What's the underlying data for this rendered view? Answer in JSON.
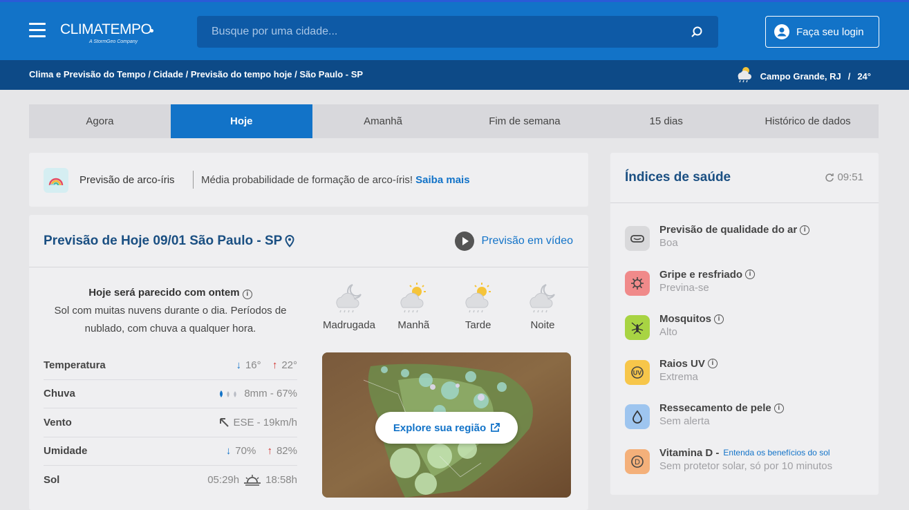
{
  "header": {
    "logo_text": "CLIMATEMPO",
    "logo_subtitle": "A StormGeo Company",
    "search_placeholder": "Busque por uma cidade...",
    "login_label": "Faça seu login"
  },
  "breadcrumb": {
    "items": [
      "Clima e Previsão do Tempo",
      "Cidade",
      "Previsão do tempo hoje",
      "São Paulo - SP"
    ],
    "separator": " / "
  },
  "current_location": {
    "city": "Campo Grande, RJ",
    "temp": "24°",
    "icon": "sun-cloud-rain-icon"
  },
  "tabs": [
    {
      "label": "Agora",
      "active": false
    },
    {
      "label": "Hoje",
      "active": true
    },
    {
      "label": "Amanhã",
      "active": false
    },
    {
      "label": "Fim de semana",
      "active": false
    },
    {
      "label": "15 dias",
      "active": false
    },
    {
      "label": "Histórico de dados",
      "active": false
    }
  ],
  "rainbow": {
    "title": "Previsão de arco-íris",
    "text": "Média probabilidade de formação de arco-íris!",
    "link": "Saiba mais"
  },
  "forecast": {
    "title": "Previsão de Hoje 09/01 São Paulo - SP",
    "video_label": "Previsão em vídeo",
    "summary_heading": "Hoje será parecido com ontem",
    "summary_text": "Sol com muitas nuvens durante o dia. Períodos de nublado, com chuva a qualquer hora.",
    "periods": [
      {
        "label": "Madrugada",
        "icon": "moon-cloud-rain-icon"
      },
      {
        "label": "Manhã",
        "icon": "sun-cloud-rain-icon"
      },
      {
        "label": "Tarde",
        "icon": "sun-cloud-rain-icon"
      },
      {
        "label": "Noite",
        "icon": "moon-cloud-rain-icon"
      }
    ],
    "stats": {
      "temperatura": {
        "label": "Temperatura",
        "min": "16°",
        "max": "22°"
      },
      "chuva": {
        "label": "Chuva",
        "value": "8mm - 67%"
      },
      "vento": {
        "label": "Vento",
        "value": "ESE - 19km/h"
      },
      "umidade": {
        "label": "Umidade",
        "min": "70%",
        "max": "82%"
      },
      "sol": {
        "label": "Sol",
        "sunrise": "05:29h",
        "sunset": "18:58h"
      }
    },
    "map_button": "Explore sua região"
  },
  "health": {
    "title": "Índices de saúde",
    "time": "09:51",
    "items": [
      {
        "name": "Previsão de qualidade do ar",
        "value": "Boa",
        "color": "#d9d9db",
        "icon": "air-quality-icon"
      },
      {
        "name": "Gripe e resfriado",
        "value": "Previna-se",
        "color": "#f08a8a",
        "icon": "virus-icon"
      },
      {
        "name": "Mosquitos",
        "value": "Alto",
        "color": "#a8d443",
        "icon": "mosquito-icon"
      },
      {
        "name": "Raios UV",
        "value": "Extrema",
        "color": "#f7c64a",
        "icon": "uv-icon"
      },
      {
        "name": "Ressecamento de pele",
        "value": "Sem alerta",
        "color": "#9ec5ef",
        "icon": "drop-icon"
      },
      {
        "name": "Vitamina D -",
        "link": "Entenda os benefícios do sol",
        "value": "Sem protetor solar, só por 10 minutos",
        "color": "#f4b07a",
        "icon": "vitamin-d-icon"
      }
    ]
  }
}
